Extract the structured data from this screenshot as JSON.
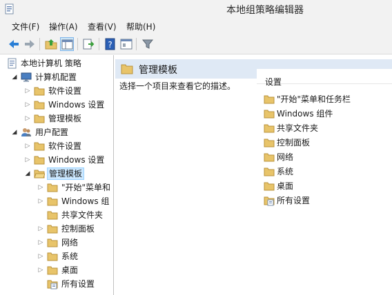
{
  "window": {
    "title": "本地组策略编辑器"
  },
  "menu": {
    "items": [
      "文件(F)",
      "操作(A)",
      "查看(V)",
      "帮助(H)"
    ]
  },
  "tree": {
    "root": "本地计算机 策略",
    "computer_config": "计算机配置",
    "computer_children": [
      "软件设置",
      "Windows 设置",
      "管理模板"
    ],
    "user_config": "用户配置",
    "user_children": [
      "软件设置",
      "Windows 设置",
      "管理模板"
    ],
    "admin_templates_children": [
      "\"开始\"菜单和",
      "Windows 组",
      "共享文件夹",
      "控制面板",
      "网络",
      "系统",
      "桌面",
      "所有设置"
    ]
  },
  "content": {
    "header_title": "管理模板",
    "description": "选择一个项目来查看它的描述。",
    "column_header": "设置",
    "items": [
      "\"开始\"菜单和任务栏",
      "Windows 组件",
      "共享文件夹",
      "控制面板",
      "网络",
      "系统",
      "桌面",
      "所有设置"
    ]
  },
  "colors": {
    "folder": "#e8c46a",
    "selection": "#cce8ff",
    "header_band": "#dfe9f5",
    "chrome": "#f2f2f2"
  }
}
